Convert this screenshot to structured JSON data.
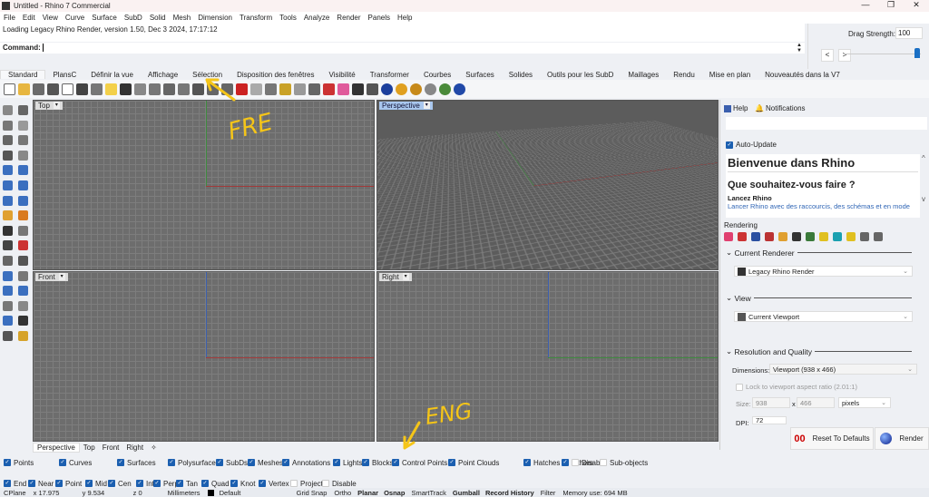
{
  "window": {
    "title": "Untitled - Rhino 7 Commercial",
    "minimize": "—",
    "maximize": "❐",
    "close": "✕"
  },
  "menu": [
    "File",
    "Edit",
    "View",
    "Curve",
    "Surface",
    "SubD",
    "Solid",
    "Mesh",
    "Dimension",
    "Transform",
    "Tools",
    "Analyze",
    "Render",
    "Panels",
    "Help"
  ],
  "command": {
    "history": "Loading Legacy Rhino Render, version 1.50, Dec  3 2024, 17:17:12",
    "label": "Command:",
    "value": ""
  },
  "drag_strength": {
    "label": "Drag Strength:",
    "value": "100",
    "prev": "<",
    "next": ">",
    "slider_percent": 100
  },
  "toolbar_tabs": [
    "Standard",
    "PlansC",
    "Définir la vue",
    "Affichage",
    "Sélection",
    "Disposition des fenêtres",
    "Visibilité",
    "Transformer",
    "Courbes",
    "Surfaces",
    "Solides",
    "Outils pour les SubD",
    "Maillages",
    "Rendu",
    "Mise en plan",
    "Nouveautés dans la V7"
  ],
  "toolbar_colors": [
    "#ffffff",
    "#e7b640",
    "#6b6b6b",
    "#555",
    "#fff",
    "#444",
    "#777",
    "#f3d04a",
    "#333",
    "#888",
    "#777",
    "#666",
    "#777",
    "#555",
    "#666",
    "#666",
    "#c22",
    "#aaa",
    "#777",
    "#c9a227",
    "#999",
    "#666",
    "#c33",
    "#e05b9b",
    "#333",
    "#555",
    "#1c3f9c",
    "#e0a020",
    "#c78a1a",
    "#888",
    "#4a8a3a",
    "#2149a8"
  ],
  "left_tool_colors": [
    "#888",
    "#666",
    "#777",
    "#999",
    "#666",
    "#777",
    "#555",
    "#888",
    "#3b6fbf",
    "#3b6fbf",
    "#3b6fbf",
    "#3b6fbf",
    "#3b6fbf",
    "#3b6fbf",
    "#e0a030",
    "#d97a20",
    "#333",
    "#777",
    "#444",
    "#c33",
    "#666",
    "#555",
    "#3b6fbf",
    "#777",
    "#3b6fbf",
    "#3b6fbf",
    "#777",
    "#888",
    "#3b6fbf",
    "#333",
    "#555",
    "#d6a32a"
  ],
  "viewports": [
    {
      "name": "Top"
    },
    {
      "name": "Perspective"
    },
    {
      "name": "Front"
    },
    {
      "name": "Right"
    }
  ],
  "viewport_tabs": [
    "Perspective",
    "Top",
    "Front",
    "Right",
    "✧"
  ],
  "annotations": {
    "fre": "FRE",
    "eng": "ENG",
    "color": "#f5c518"
  },
  "filters": [
    {
      "label": "Points",
      "checked": true
    },
    {
      "label": "Curves",
      "checked": true
    },
    {
      "label": "Surfaces",
      "checked": true
    },
    {
      "label": "Polysurfaces",
      "checked": true
    },
    {
      "label": "SubDs",
      "checked": true
    },
    {
      "label": "Meshes",
      "checked": true
    },
    {
      "label": "Annotations",
      "checked": true
    },
    {
      "label": "Lights",
      "checked": true
    },
    {
      "label": "Blocks",
      "checked": true
    },
    {
      "label": "Control Points",
      "checked": true
    },
    {
      "label": "Point Clouds",
      "checked": true
    },
    {
      "label": "Hatches",
      "checked": true
    },
    {
      "label": "Others",
      "checked": true
    },
    {
      "label": "Disable",
      "checked": false
    },
    {
      "label": "Sub-objects",
      "checked": false
    }
  ],
  "osnaps": [
    {
      "label": "End",
      "checked": true
    },
    {
      "label": "Near",
      "checked": true
    },
    {
      "label": "Point",
      "checked": true
    },
    {
      "label": "Mid",
      "checked": true
    },
    {
      "label": "Cen",
      "checked": true
    },
    {
      "label": "Int",
      "checked": true
    },
    {
      "label": "Perp",
      "checked": true
    },
    {
      "label": "Tan",
      "checked": true
    },
    {
      "label": "Quad",
      "checked": true
    },
    {
      "label": "Knot",
      "checked": true
    },
    {
      "label": "Vertex",
      "checked": true
    },
    {
      "label": "Project",
      "checked": false
    },
    {
      "label": "Disable",
      "checked": false
    }
  ],
  "status": {
    "cplane": "CPlane",
    "x": "x 17.975",
    "y": "y 9.534",
    "z": "z 0",
    "units": "Millimeters",
    "layer": "Default",
    "grid_snap": "Grid Snap",
    "ortho": "Ortho",
    "planar": "Planar",
    "osnap": "Osnap",
    "smarttrack": "SmartTrack",
    "gumball": "Gumball",
    "record_history": "Record History",
    "filter": "Filter",
    "memory": "Memory use: 694 MB"
  },
  "panel": {
    "tabs": [
      "Help",
      "Notifications"
    ],
    "auto_update": "Auto-Update",
    "welcome_title": "Bienvenue dans Rhino",
    "welcome_q": "Que souhaitez-vous faire ?",
    "launch_title": "Lancez Rhino",
    "launch_link": "Lancer Rhino avec des raccourcis, des schémas et en mode",
    "rendering_label": "Rendering",
    "current_renderer": "Current Renderer",
    "renderer_value": "Legacy Rhino Render",
    "view": "View",
    "view_value": "Current Viewport",
    "res_quality": "Resolution and Quality",
    "dimensions_label": "Dimensions:",
    "dimensions_value": "Viewport (938 x 466)",
    "lock_aspect": "Lock to viewport aspect ratio (2.01:1)",
    "size_label": "Size:",
    "width": "938",
    "x": "x",
    "height": "466",
    "size_units": "pixels",
    "dpi_label": "DPI:",
    "dpi": "72",
    "reset": "Reset To Defaults",
    "render": "Render"
  }
}
